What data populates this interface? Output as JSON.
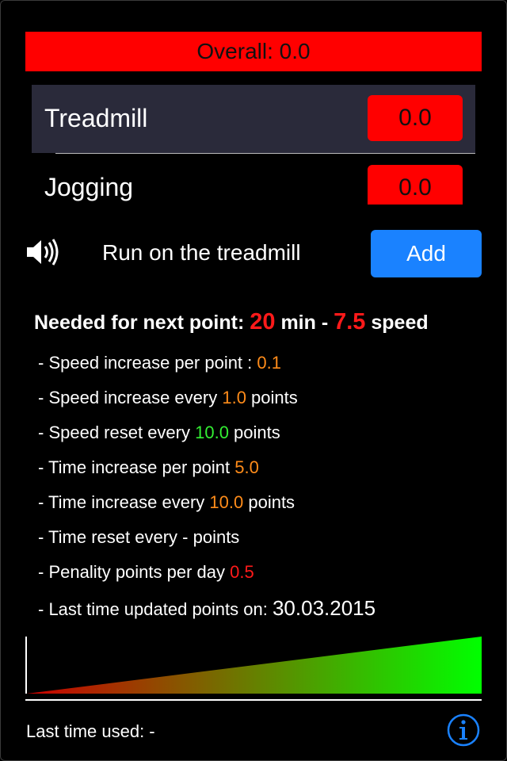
{
  "overall": {
    "label": "Overall: 0.0"
  },
  "categories": [
    {
      "label": "Treadmill",
      "score": "0.0"
    },
    {
      "label": "Jogging",
      "score": "0.0"
    }
  ],
  "exercise": {
    "name": "Run on the treadmill",
    "add_label": "Add"
  },
  "needed": {
    "prefix": "Needed for next point: ",
    "minutes": "20",
    "minutes_unit": " min - ",
    "speed": "7.5",
    "speed_unit": " speed"
  },
  "details": [
    {
      "prefix": "- Speed increase per point : ",
      "value": "0.1",
      "suffix": ""
    },
    {
      "prefix": "- Speed increase every ",
      "value": "1.0",
      "suffix": " points"
    },
    {
      "prefix": "- Speed reset every ",
      "value": "10.0",
      "suffix": " points"
    },
    {
      "prefix": "- Time increase per point ",
      "value": "5.0",
      "suffix": ""
    },
    {
      "prefix": "- Time increase every ",
      "value": "10.0",
      "suffix": " points"
    },
    {
      "prefix": "- Time reset every - points",
      "value": "",
      "suffix": ""
    },
    {
      "prefix": "- Penality points per day ",
      "value": "0.5",
      "suffix": ""
    },
    {
      "prefix": "- Last time updated points on: ",
      "value": "30.03.2015",
      "suffix": ""
    }
  ],
  "footer": {
    "last_used": "Last time used: -"
  },
  "colors": {
    "badge_red": "#ff0000",
    "accent_blue": "#1a82ff",
    "value_orange": "#ff8c1a",
    "value_green": "#33ee33",
    "value_red": "#ff1a1a",
    "progress_start": "#cc0000",
    "progress_end": "#00ff00"
  },
  "icons": {
    "sound": "speaker-icon",
    "info": "info-icon"
  }
}
